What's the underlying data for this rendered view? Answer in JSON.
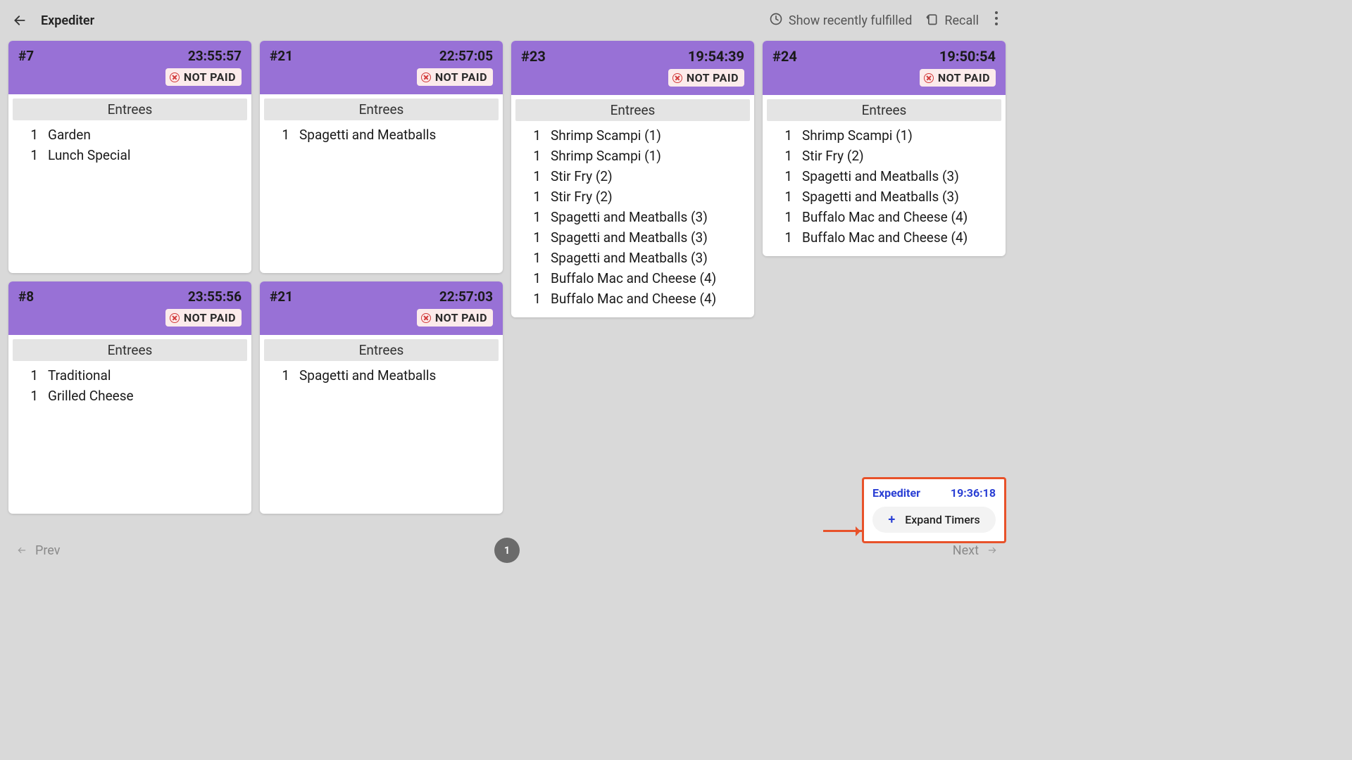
{
  "header": {
    "title": "Expediter",
    "show_recent_label": "Show recently fulfilled",
    "recall_label": "Recall"
  },
  "statuses": {
    "not_paid": "NOT PAID"
  },
  "section_label": "Entrees",
  "columns": [
    [
      {
        "id": "#7",
        "time": "23:55:57",
        "status": "not_paid",
        "items": [
          {
            "qty": 1,
            "name": "Garden"
          },
          {
            "qty": 1,
            "name": "Lunch Special"
          }
        ]
      },
      {
        "id": "#8",
        "time": "23:55:56",
        "status": "not_paid",
        "items": [
          {
            "qty": 1,
            "name": "Traditional"
          },
          {
            "qty": 1,
            "name": "Grilled Cheese"
          }
        ]
      }
    ],
    [
      {
        "id": "#21",
        "time": "22:57:05",
        "status": "not_paid",
        "items": [
          {
            "qty": 1,
            "name": "Spagetti and Meatballs"
          }
        ]
      },
      {
        "id": "#21",
        "time": "22:57:03",
        "status": "not_paid",
        "items": [
          {
            "qty": 1,
            "name": "Spagetti and Meatballs"
          }
        ]
      }
    ],
    [
      {
        "id": "#23",
        "time": "19:54:39",
        "status": "not_paid",
        "items": [
          {
            "qty": 1,
            "name": "Shrimp Scampi (1)"
          },
          {
            "qty": 1,
            "name": "Shrimp Scampi (1)"
          },
          {
            "qty": 1,
            "name": "Stir Fry (2)"
          },
          {
            "qty": 1,
            "name": "Stir Fry (2)"
          },
          {
            "qty": 1,
            "name": "Spagetti and Meatballs (3)"
          },
          {
            "qty": 1,
            "name": "Spagetti and Meatballs (3)"
          },
          {
            "qty": 1,
            "name": "Spagetti and Meatballs (3)"
          },
          {
            "qty": 1,
            "name": "Buffalo Mac and Cheese (4)"
          },
          {
            "qty": 1,
            "name": "Buffalo Mac and Cheese (4)"
          }
        ]
      }
    ],
    [
      {
        "id": "#24",
        "time": "19:50:54",
        "status": "not_paid",
        "items": [
          {
            "qty": 1,
            "name": "Shrimp Scampi (1)"
          },
          {
            "qty": 1,
            "name": "Stir Fry (2)"
          },
          {
            "qty": 1,
            "name": "Spagetti and Meatballs (3)"
          },
          {
            "qty": 1,
            "name": "Spagetti and Meatballs (3)"
          },
          {
            "qty": 1,
            "name": "Buffalo Mac and Cheese (4)"
          },
          {
            "qty": 1,
            "name": "Buffalo Mac and Cheese (4)"
          }
        ]
      }
    ]
  ],
  "pagination": {
    "prev": "Prev",
    "next": "Next",
    "page": "1"
  },
  "timer_widget": {
    "title": "Expediter",
    "time": "19:36:18",
    "expand_label": "Expand Timers"
  }
}
